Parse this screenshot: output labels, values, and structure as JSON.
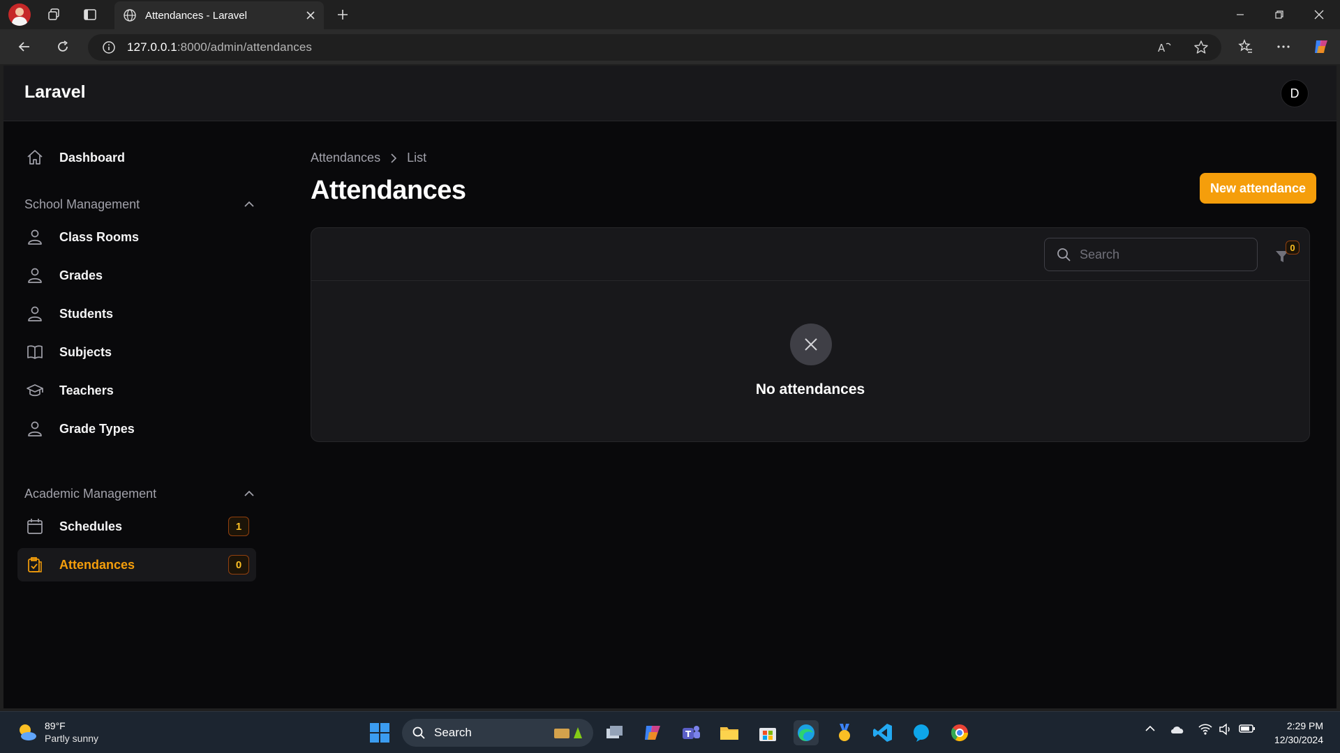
{
  "browser": {
    "tab_title": "Attendances - Laravel",
    "url_host": "127.0.0.1",
    "url_path": ":8000/admin/attendances"
  },
  "app": {
    "brand": "Laravel",
    "user_initial": "D"
  },
  "sidebar": {
    "dashboard": "Dashboard",
    "groups": [
      {
        "label": "School Management",
        "items": [
          "Class Rooms",
          "Grades",
          "Students",
          "Subjects",
          "Teachers",
          "Grade Types"
        ]
      },
      {
        "label": "Academic Management",
        "items": [
          {
            "label": "Schedules",
            "badge": "1"
          },
          {
            "label": "Attendances",
            "badge": "0",
            "active": true
          }
        ]
      }
    ]
  },
  "main": {
    "breadcrumb": [
      "Attendances",
      "List"
    ],
    "title": "Attendances",
    "new_button": "New attendance",
    "search_placeholder": "Search",
    "filter_count": "0",
    "empty_text": "No attendances"
  },
  "taskbar": {
    "temperature": "89°F",
    "weather": "Partly sunny",
    "search_label": "Search",
    "time": "2:29 PM",
    "date": "12/30/2024"
  },
  "colors": {
    "accent": "#f59e0b",
    "background": "#09090b",
    "panel": "#18181b"
  }
}
